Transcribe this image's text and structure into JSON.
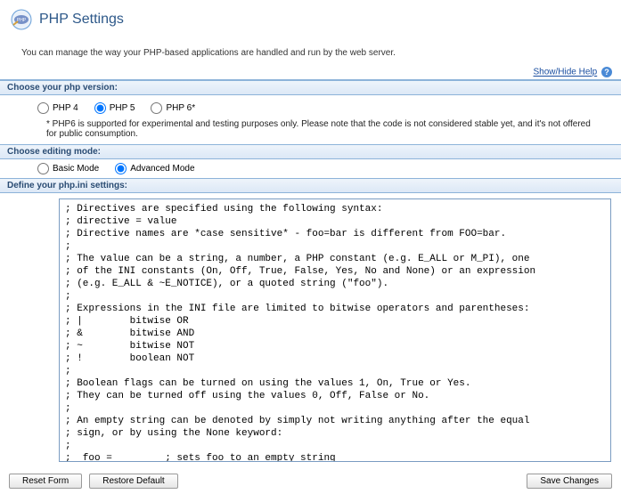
{
  "page": {
    "title": "PHP Settings",
    "intro": "You can manage the way your PHP-based applications are handled and run by the web server.",
    "help_link": "Show/Hide Help"
  },
  "php_version": {
    "heading": "Choose your php version:",
    "options": [
      {
        "label": "PHP 4",
        "checked": false
      },
      {
        "label": "PHP 5",
        "checked": true
      },
      {
        "label": "PHP 6*",
        "checked": false
      }
    ],
    "note": "* PHP6 is supported for experimental and testing purposes only. Please note that the code is not considered stable yet, and it's not offered for public consumption."
  },
  "edit_mode": {
    "heading": "Choose editing mode:",
    "options": [
      {
        "label": "Basic Mode",
        "checked": false
      },
      {
        "label": "Advanced Mode",
        "checked": true
      }
    ]
  },
  "settings": {
    "heading": "Define your php.ini settings:",
    "content": "; Directives are specified using the following syntax:\n; directive = value\n; Directive names are *case sensitive* - foo=bar is different from FOO=bar.\n;\n; The value can be a string, a number, a PHP constant (e.g. E_ALL or M_PI), one\n; of the INI constants (On, Off, True, False, Yes, No and None) or an expression\n; (e.g. E_ALL & ~E_NOTICE), or a quoted string (\"foo\").\n;\n; Expressions in the INI file are limited to bitwise operators and parentheses:\n; |        bitwise OR\n; &        bitwise AND\n; ~        bitwise NOT\n; !        boolean NOT\n;\n; Boolean flags can be turned on using the values 1, On, True or Yes.\n; They can be turned off using the values 0, Off, False or No.\n;\n; An empty string can be denoted by simply not writing anything after the equal\n; sign, or by using the None keyword:\n;\n;  foo =         ; sets foo to an empty string\n;  foo = none    ; sets foo to an empty string\n;  foo = \"none\"  ; sets foo to the string 'none'\n;\n; If you use constants in your value, and these constants belong to a\n; dynamically loaded extension (either a PHP extension or a Zend extension),"
  },
  "buttons": {
    "reset": "Reset Form",
    "restore": "Restore Default",
    "save": "Save Changes"
  }
}
